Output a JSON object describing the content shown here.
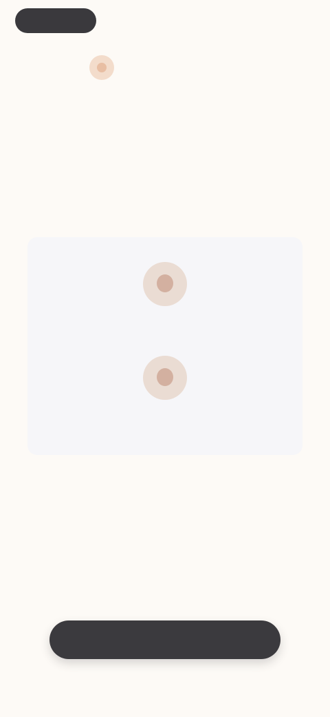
{
  "top_bar": {
    "back_label": "",
    "right_text": ""
  },
  "brand": {
    "name": ""
  },
  "hero": {
    "small_note": "",
    "tagline": "",
    "headline": "",
    "subhead": ""
  },
  "card": {
    "items": [
      {
        "label": "",
        "sub": ""
      },
      {
        "label": "",
        "sub": ""
      }
    ]
  },
  "question": "",
  "disclaimer": "",
  "cta": {
    "label": ""
  },
  "colors": {
    "background": "#fdfaf6",
    "accent": "#e3bfa4",
    "button": "#3b3a3e",
    "card": "#f6f6f9"
  },
  "icons": {
    "brand": "brand-logo-icon",
    "avatar": "person-avatar-icon"
  }
}
